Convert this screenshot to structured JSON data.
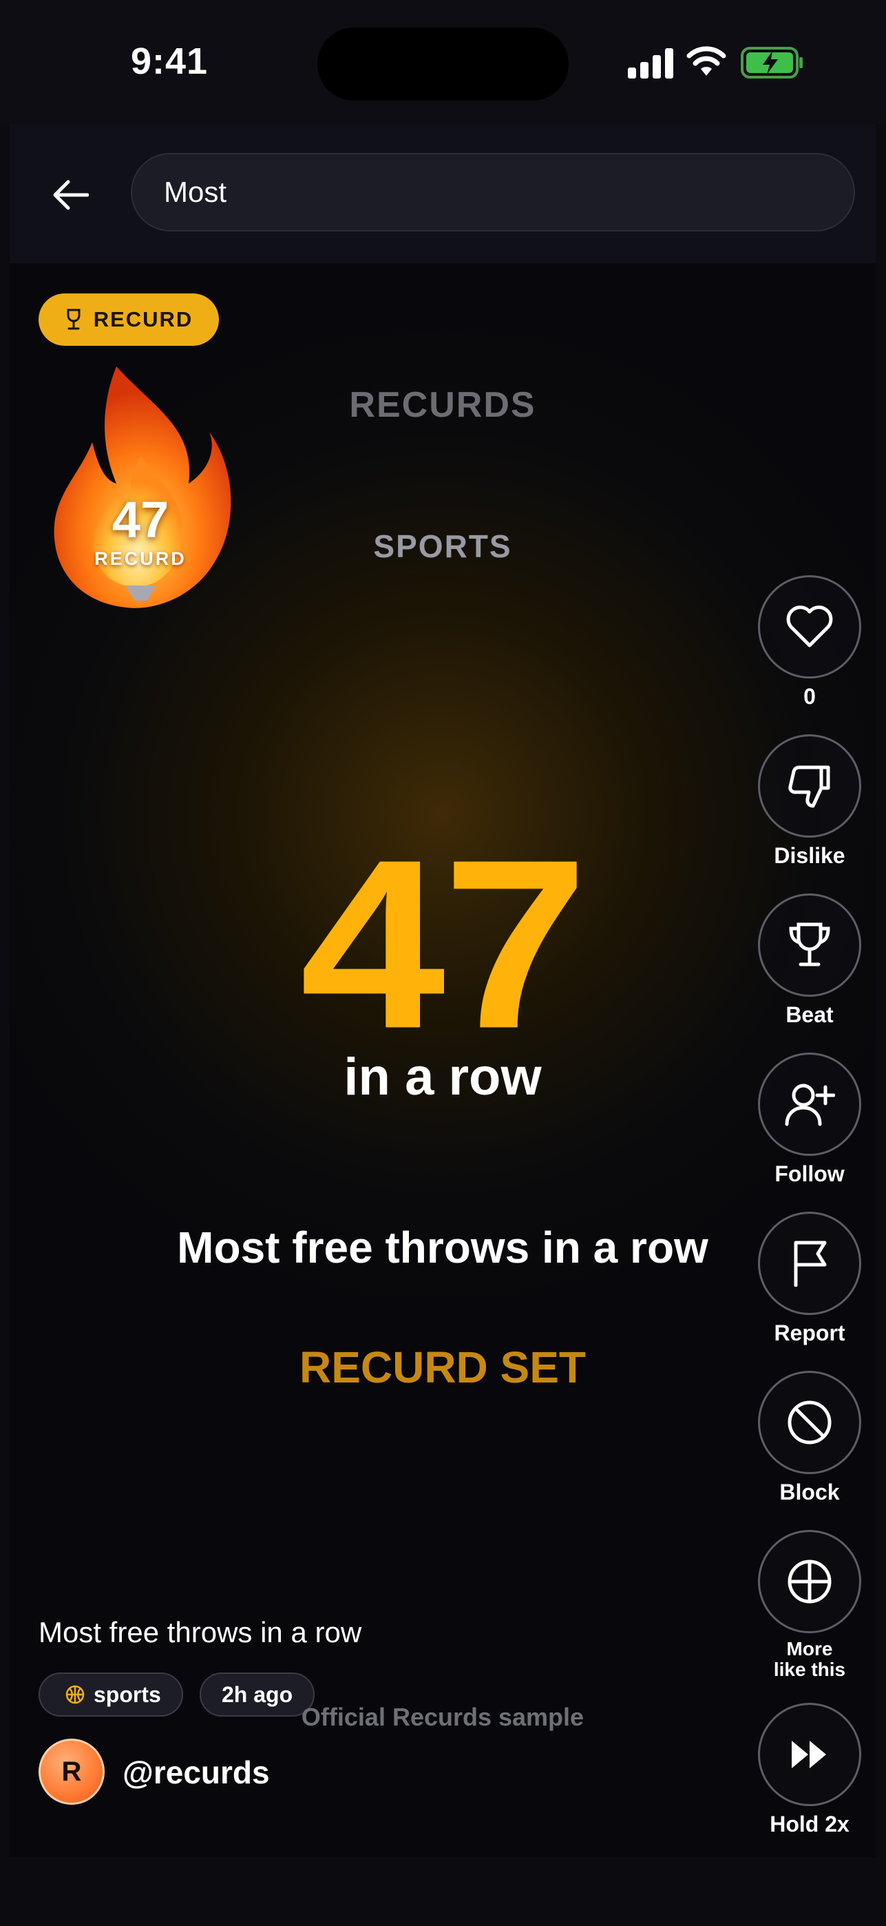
{
  "status_bar": {
    "time": "9:41"
  },
  "search": {
    "value": "Most"
  },
  "badge": {
    "label": "RECURD"
  },
  "flame": {
    "number": "47",
    "label": "RECURD"
  },
  "brand": "RECURDS",
  "category": "SPORTS",
  "record": {
    "value": "47",
    "unit": "in a row",
    "title": "Most free throws in a row",
    "status": "RECURD SET"
  },
  "actions": [
    {
      "name": "like",
      "label": "0",
      "icon": "heart-icon"
    },
    {
      "name": "dislike",
      "label": "Dislike",
      "icon": "thumbs-down-icon"
    },
    {
      "name": "beat",
      "label": "Beat",
      "icon": "trophy-icon"
    },
    {
      "name": "follow",
      "label": "Follow",
      "icon": "user-plus-icon"
    },
    {
      "name": "report",
      "label": "Report",
      "icon": "flag-icon"
    },
    {
      "name": "block",
      "label": "Block",
      "icon": "block-icon"
    },
    {
      "name": "more-like-this",
      "label": "More like this",
      "icon": "crosshair-icon"
    },
    {
      "name": "hold-2x",
      "label": "Hold 2x",
      "icon": "fast-forward-icon"
    }
  ],
  "post": {
    "caption": "Most free throws in a row",
    "tags": {
      "sports": "sports",
      "time": "2h ago"
    },
    "watermark": "Official Recurds sample",
    "avatar_initial": "R",
    "handle": "@recurds"
  },
  "colors": {
    "accent": "#ffb30a",
    "badge": "#f0ae16",
    "status": "#c78812",
    "background": "#08080c"
  }
}
